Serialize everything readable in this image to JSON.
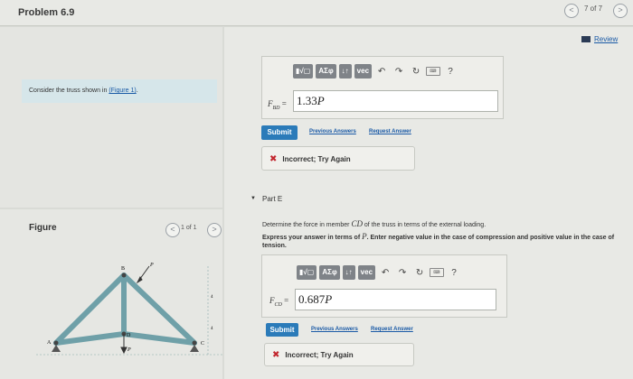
{
  "header": {
    "problem_title": "Problem 6.9",
    "page_counter": "7 of 7",
    "prev_glyph": "<",
    "next_glyph": ">"
  },
  "review": {
    "label": "Review"
  },
  "intro": {
    "text": "Consider the truss shown in",
    "link": "(Figure 1)",
    "period": "."
  },
  "figure": {
    "label": "Figure",
    "counter": "1 of 1",
    "prev_glyph": "<",
    "next_glyph": ">",
    "joint_labels": {
      "A": "A",
      "B": "B",
      "C": "C",
      "D": "D"
    },
    "load_labels": [
      "P",
      "P"
    ],
    "dim_labels": [
      "4",
      "4"
    ]
  },
  "toolbar": {
    "templates": "▮√▢",
    "greek": "ΑΣφ",
    "arrows": "↓↑",
    "vec": "vec",
    "undo": "↶",
    "redo": "↷",
    "reset": "↻",
    "keyboard": "⌨",
    "help": "?"
  },
  "part_d": {
    "label_main": "F",
    "label_sub": "BD",
    "equals": "=",
    "value_num": "1.33",
    "value_var": "P",
    "submit": "Submit",
    "previous_answers": "Previous Answers",
    "request_answer": "Request Answer",
    "feedback": "Incorrect; Try Again"
  },
  "part_e": {
    "caret": "▼",
    "label": "Part E",
    "question_pre": "Determine the force in member",
    "question_member": "CD",
    "question_post": "of the truss in terms of the external loading.",
    "instruction_1": "Express your answer in terms of",
    "instruction_var": "P",
    "instruction_2": ". Enter negative value in the case of compression and positive value in the case of tension.",
    "label_main": "F",
    "label_sub": "CD",
    "equals": "=",
    "value_num": "0.687",
    "value_var": "P",
    "submit": "Submit",
    "previous_answers": "Previous Answers",
    "request_answer": "Request Answer",
    "feedback": "Incorrect; Try Again"
  }
}
